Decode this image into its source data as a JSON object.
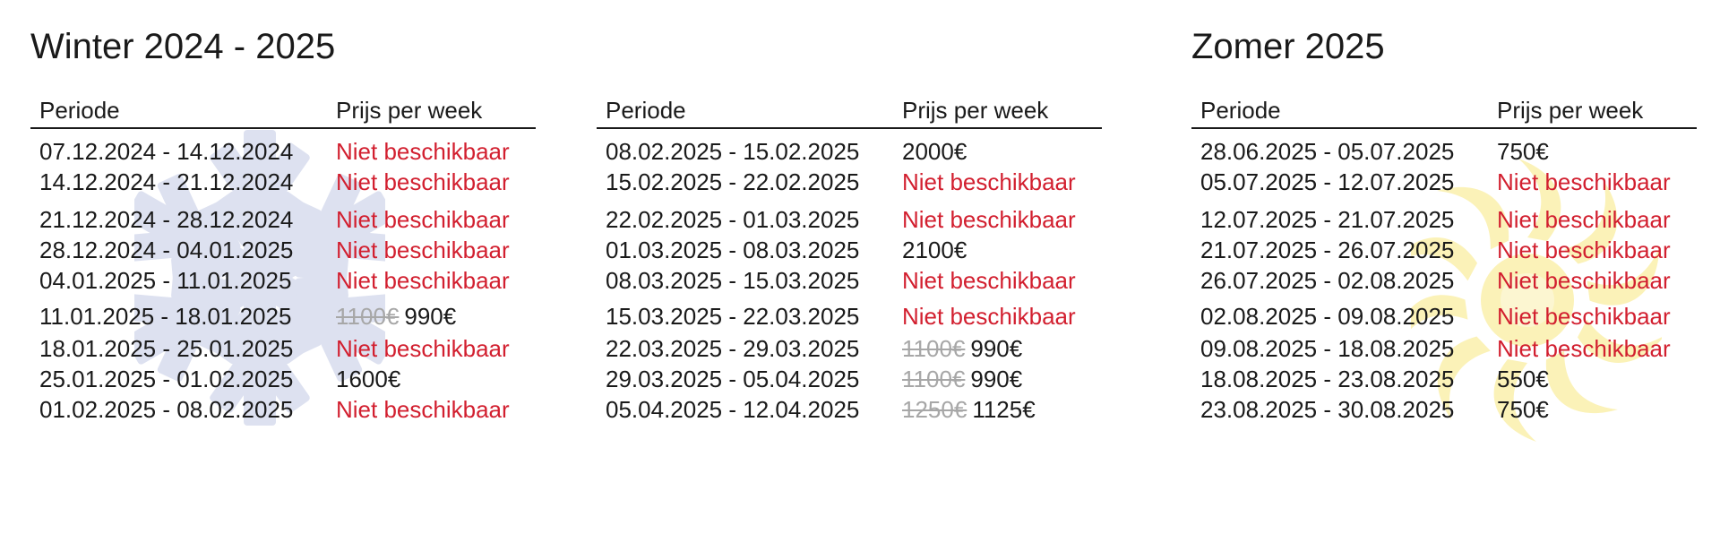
{
  "colors": {
    "text": "#1a1a1a",
    "unavailable": "#d21f2f",
    "old_price": "#a7a7a7",
    "snowflake": "#dde1f0",
    "sun": "#fbf2b8"
  },
  "icons": {
    "winter_background": "snowflake-icon",
    "summer_background": "sun-icon"
  },
  "winter": {
    "title": "Winter 2024 - 2025",
    "header_period": "Periode",
    "header_price": "Prijs per week",
    "rows_left": [
      {
        "period": "07.12.2024 - 14.12.2024",
        "price": "Niet beschikbaar",
        "old_price": "",
        "status": "unavailable"
      },
      {
        "period": "14.12.2024 - 21.12.2024",
        "price": "Niet beschikbaar",
        "old_price": "",
        "status": "unavailable"
      },
      {
        "period": "21.12.2024 - 28.12.2024",
        "price": "Niet beschikbaar",
        "old_price": "",
        "status": "unavailable"
      },
      {
        "period": "28.12.2024 - 04.01.2025",
        "price": "Niet beschikbaar",
        "old_price": "",
        "status": "unavailable"
      },
      {
        "period": "04.01.2025 - 11.01.2025",
        "price": "Niet beschikbaar",
        "old_price": "",
        "status": "unavailable"
      },
      {
        "period": "11.01.2025 - 18.01.2025",
        "price": "990€",
        "old_price": "1100€",
        "status": "available"
      },
      {
        "period": "18.01.2025 - 25.01.2025",
        "price": "Niet beschikbaar",
        "old_price": "",
        "status": "unavailable"
      },
      {
        "period": "25.01.2025 - 01.02.2025",
        "price": "1600€",
        "old_price": "",
        "status": "available"
      },
      {
        "period": "01.02.2025 - 08.02.2025",
        "price": "Niet beschikbaar",
        "old_price": "",
        "status": "unavailable"
      }
    ],
    "rows_right": [
      {
        "period": "08.02.2025 - 15.02.2025",
        "price": "2000€",
        "old_price": "",
        "status": "available"
      },
      {
        "period": "15.02.2025 - 22.02.2025",
        "price": "Niet beschikbaar",
        "old_price": "",
        "status": "unavailable"
      },
      {
        "period": "22.02.2025 - 01.03.2025",
        "price": "Niet beschikbaar",
        "old_price": "",
        "status": "unavailable"
      },
      {
        "period": "01.03.2025 - 08.03.2025",
        "price": "2100€",
        "old_price": "",
        "status": "available"
      },
      {
        "period": "08.03.2025 - 15.03.2025",
        "price": "Niet beschikbaar",
        "old_price": "",
        "status": "unavailable"
      },
      {
        "period": "15.03.2025 - 22.03.2025",
        "price": "Niet beschikbaar",
        "old_price": "",
        "status": "unavailable"
      },
      {
        "period": "22.03.2025 - 29.03.2025",
        "price": "990€",
        "old_price": "1100€",
        "status": "available"
      },
      {
        "period": "29.03.2025 - 05.04.2025",
        "price": "990€",
        "old_price": "1100€",
        "status": "available"
      },
      {
        "period": "05.04.2025 - 12.04.2025",
        "price": "1125€",
        "old_price": "1250€",
        "status": "available"
      }
    ]
  },
  "summer": {
    "title": "Zomer 2025",
    "header_period": "Periode",
    "header_price": "Prijs per week",
    "rows": [
      {
        "period": "28.06.2025 - 05.07.2025",
        "price": "750€",
        "old_price": "",
        "status": "available"
      },
      {
        "period": "05.07.2025 - 12.07.2025",
        "price": "Niet beschikbaar",
        "old_price": "",
        "status": "unavailable"
      },
      {
        "period": "12.07.2025 - 21.07.2025",
        "price": "Niet beschikbaar",
        "old_price": "",
        "status": "unavailable"
      },
      {
        "period": "21.07.2025 - 26.07.2025",
        "price": "Niet beschikbaar",
        "old_price": "",
        "status": "unavailable"
      },
      {
        "period": "26.07.2025 - 02.08.2025",
        "price": "Niet beschikbaar",
        "old_price": "",
        "status": "unavailable"
      },
      {
        "period": "02.08.2025 - 09.08.2025",
        "price": "Niet beschikbaar",
        "old_price": "",
        "status": "unavailable"
      },
      {
        "period": "09.08.2025 - 18.08.2025",
        "price": "Niet beschikbaar",
        "old_price": "",
        "status": "unavailable"
      },
      {
        "period": "18.08.2025 - 23.08.2025",
        "price": "550€",
        "old_price": "",
        "status": "available"
      },
      {
        "period": "23.08.2025 - 30.08.2025",
        "price": "750€",
        "old_price": "",
        "status": "available"
      }
    ]
  }
}
